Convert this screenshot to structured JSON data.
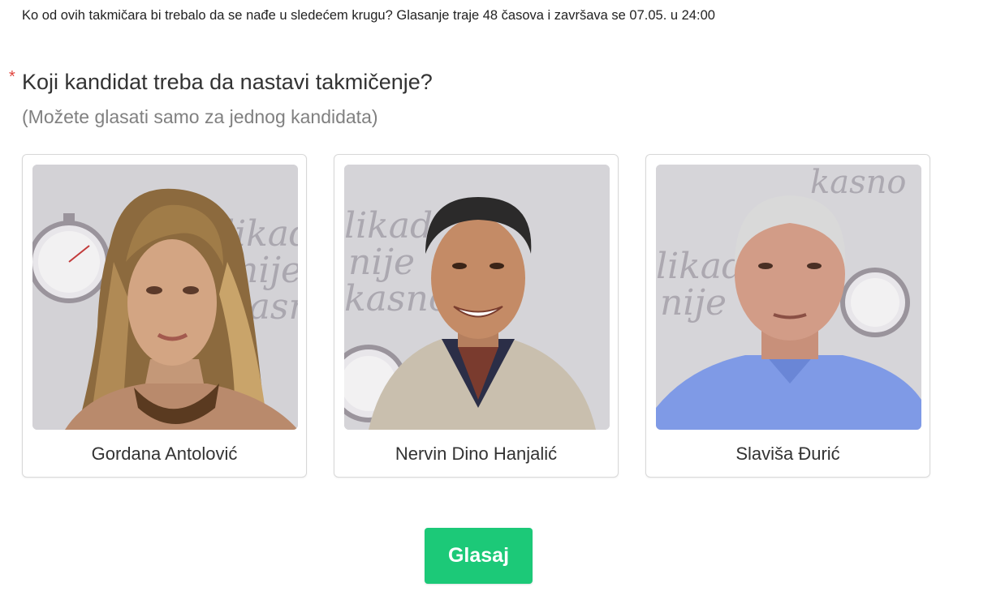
{
  "poll": {
    "intro": "Ko od ovih takmičara bi trebalo da se nađe u sledećem krugu? Glasanje traje 48 časova i završava se 07.05. u 24:00",
    "required_marker": "*",
    "question": "Koji kandidat treba da nastavi takmičenje?",
    "subtitle": "(Možete glasati samo za jednog kandidata)"
  },
  "candidates": [
    {
      "name": "Gordana Antolović",
      "photo_icon": "candidate-photo-woman-blonde"
    },
    {
      "name": "Nervin Dino Hanjalić",
      "photo_icon": "candidate-photo-man-dark-hair"
    },
    {
      "name": "Slaviša Đurić",
      "photo_icon": "candidate-photo-man-bald"
    }
  ],
  "backdrop_text": {
    "line1": "likad",
    "line2": "nije",
    "line3": "kasno"
  },
  "vote_button": {
    "label": "Glasaj"
  },
  "colors": {
    "accent": "#1cc978",
    "required": "#e0433d",
    "text": "#333333",
    "muted": "#808080",
    "card_border": "#d8d8d8"
  }
}
